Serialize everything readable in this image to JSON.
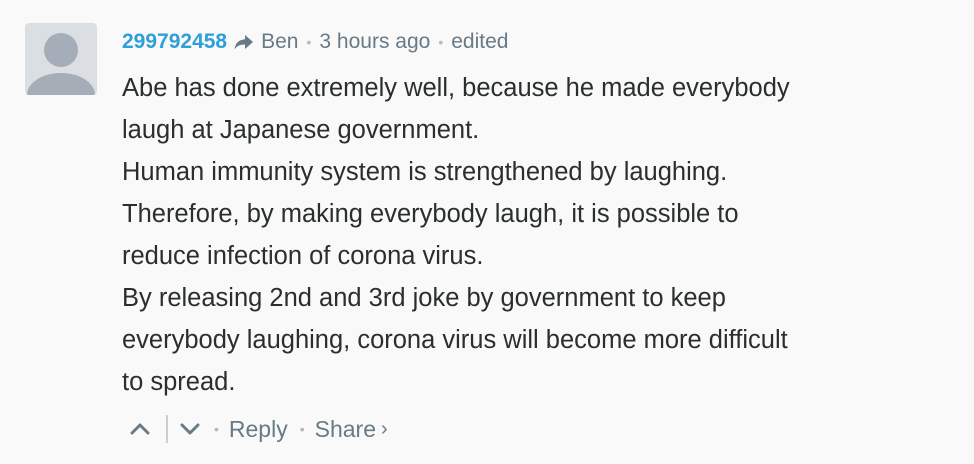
{
  "comment": {
    "author": "299792458",
    "reply_icon": "reply-arrow-icon",
    "in_reply_to": "Ben",
    "timestamp": "3 hours ago",
    "edited_label": "edited",
    "body_lines": [
      "Abe has done extremely well, because he made everybody",
      "laugh at Japanese government.",
      "Human immunity system is strengthened by laughing.",
      "Therefore, by making everybody laugh, it is possible to",
      "reduce infection of corona virus.",
      "By releasing 2nd and 3rd joke by government to keep",
      "everybody laughing, corona virus will become more difficult",
      "to spread."
    ],
    "footer": {
      "upvote_icon": "chevron-up-icon",
      "downvote_icon": "chevron-down-icon",
      "reply_label": "Reply",
      "share_label": "Share",
      "share_chevron": "›"
    }
  },
  "colors": {
    "background": "#f9f9f9",
    "author": "#2e9fd8",
    "meta": "#687a86",
    "body_text": "#2a2e2e",
    "avatar_bg": "#dbdfe4",
    "avatar_fg": "#a4adb8"
  }
}
